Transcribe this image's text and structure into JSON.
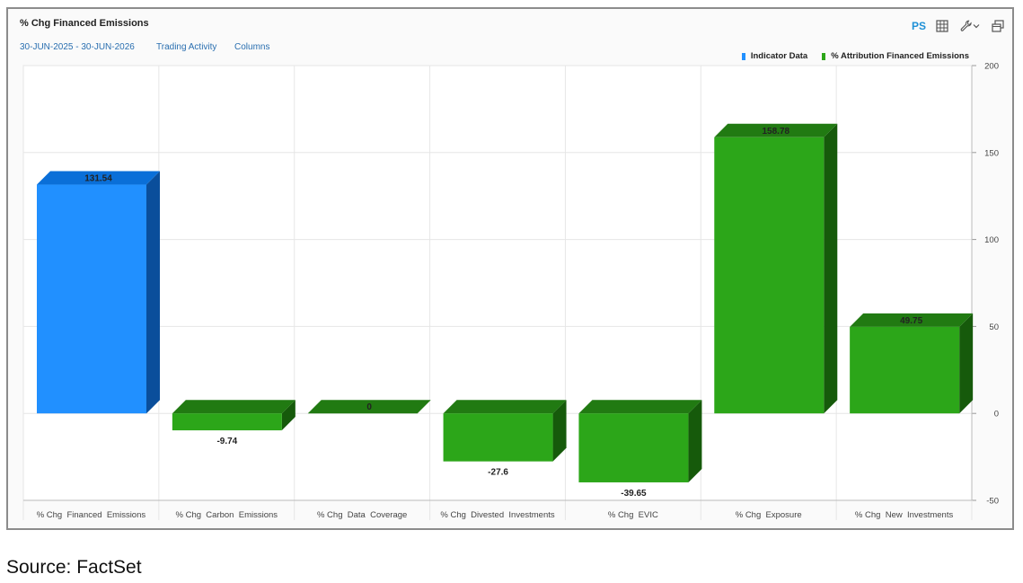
{
  "header": {
    "title": "% Chg Financed Emissions",
    "date_range": "30-JUN-2025 - 30-JUN-2026",
    "link_trading": "Trading Activity",
    "link_columns": "Columns",
    "ps_label": "PS"
  },
  "icons": {
    "table": "table-grid-icon",
    "wrench": "wrench-icon",
    "dropdown": "chevron-down-icon",
    "popout": "popout-windows-icon"
  },
  "colors": {
    "accent": "#1e90d6",
    "indicator": "#2190ff",
    "attribution": "#2ca619"
  },
  "legend": {
    "items": [
      {
        "label": "Indicator Data",
        "color": "#2190ff"
      },
      {
        "label": "% Attribution Financed Emissions",
        "color": "#2ca619"
      }
    ],
    "position": "top-right"
  },
  "chart_data": {
    "type": "bar",
    "style": "3d",
    "categories": [
      "% Chg  Financed  Emissions",
      "% Chg  Carbon  Emissions",
      "% Chg  Data  Coverage",
      "% Chg  Divested  Investments",
      "% Chg  EVIC",
      "% Chg  Exposure",
      "% Chg  New  Investments"
    ],
    "series": [
      {
        "name": "Indicator Data",
        "values": [
          131.54,
          null,
          null,
          null,
          null,
          null,
          null
        ]
      },
      {
        "name": "% Attribution Financed Emissions",
        "values": [
          null,
          -9.74,
          0,
          -27.6,
          -39.65,
          158.78,
          49.75
        ]
      }
    ],
    "data_labels": [
      "131.54",
      "-9.74",
      "0",
      "-27.6",
      "-39.65",
      "158.78",
      "49.75"
    ],
    "ylim": [
      -50,
      200
    ],
    "yticks": [
      -50,
      0,
      50,
      100,
      150,
      200
    ],
    "y_axis_side": "right",
    "grid": true
  },
  "footer": {
    "source": "Source: FactSet"
  }
}
